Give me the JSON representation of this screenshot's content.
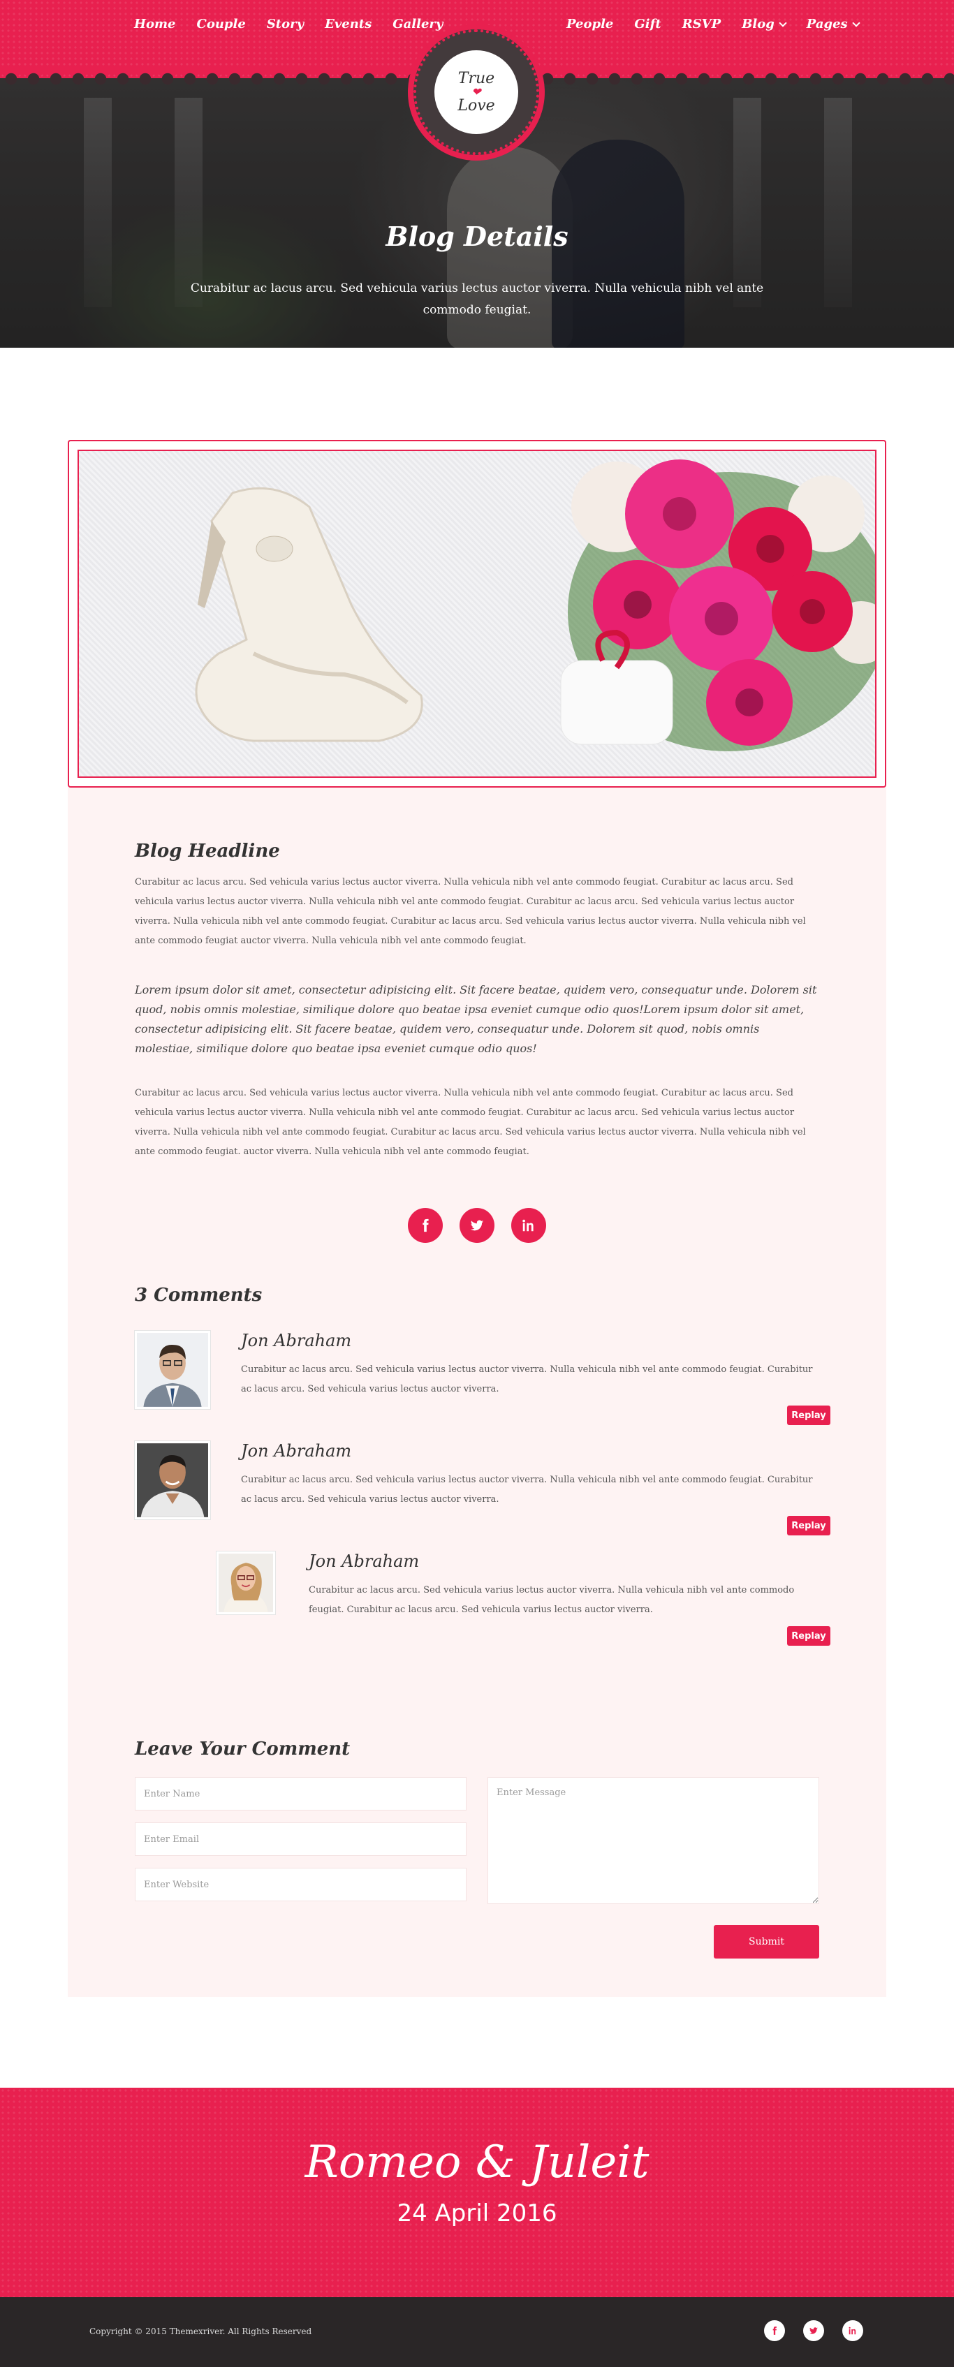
{
  "nav": {
    "left": [
      "Home",
      "Couple",
      "Story",
      "Events",
      "Gallery"
    ],
    "right": [
      "People",
      "Gift",
      "RSVP",
      "Blog",
      "Pages"
    ]
  },
  "logo": {
    "line1": "True",
    "line2": "Love"
  },
  "hero": {
    "title": "Blog Details",
    "subtitle": "Curabitur ac lacus arcu. Sed vehicula varius lectus auctor viverra. Nulla vehicula nibh vel ante commodo feugiat."
  },
  "post": {
    "headline": "Blog Headline",
    "paragraph1": "Curabitur ac lacus arcu. Sed vehicula varius lectus auctor viverra. Nulla vehicula nibh vel ante commodo feugiat. Curabitur ac lacus arcu. Sed vehicula varius lectus auctor viverra. Nulla vehicula nibh vel ante commodo feugiat. Curabitur ac lacus arcu. Sed vehicula varius lectus auctor viverra. Nulla vehicula nibh vel ante commodo feugiat. Curabitur ac lacus arcu. Sed vehicula varius lectus auctor viverra. Nulla vehicula nibh vel ante commodo feugiat auctor viverra. Nulla vehicula nibh vel ante commodo feugiat.",
    "quote": "Lorem ipsum dolor sit amet, consectetur adipisicing elit. Sit facere beatae, quidem vero, consequatur unde. Dolorem sit quod, nobis omnis molestiae, similique dolore quo beatae ipsa eveniet cumque odio quos!Lorem ipsum dolor sit amet, consectetur adipisicing elit. Sit facere beatae, quidem vero, consequatur unde. Dolorem sit quod, nobis omnis molestiae, similique dolore quo beatae ipsa eveniet cumque odio quos!",
    "paragraph2": "Curabitur ac lacus arcu. Sed vehicula varius lectus auctor viverra. Nulla vehicula nibh vel ante commodo feugiat. Curabitur ac lacus arcu. Sed vehicula varius lectus auctor viverra. Nulla vehicula nibh vel ante commodo feugiat. Curabitur ac lacus arcu. Sed vehicula varius lectus auctor viverra. Nulla vehicula nibh vel ante commodo feugiat. Curabitur ac lacus arcu. Sed vehicula varius lectus auctor viverra. Nulla vehicula nibh vel ante commodo feugiat. auctor viverra. Nulla vehicula nibh vel ante commodo feugiat."
  },
  "share": {
    "icons": [
      "facebook-icon",
      "twitter-icon",
      "linkedin-icon"
    ]
  },
  "comments": {
    "title": "3 Comments",
    "items": [
      {
        "name": "Jon Abraham",
        "text": "Curabitur ac lacus arcu. Sed vehicula varius lectus auctor viverra. Nulla vehicula nibh vel ante commodo feugiat. Curabitur ac lacus arcu. Sed vehicula varius lectus auctor viverra.",
        "reply": "Replay"
      },
      {
        "name": "Jon Abraham",
        "text": "Curabitur ac lacus arcu. Sed vehicula varius lectus auctor viverra. Nulla vehicula nibh vel ante commodo feugiat. Curabitur ac lacus arcu. Sed vehicula varius lectus auctor viverra.",
        "reply": "Replay"
      },
      {
        "name": "Jon Abraham",
        "text": "Curabitur ac lacus arcu. Sed vehicula varius lectus auctor viverra. Nulla vehicula nibh vel ante commodo feugiat. Curabitur ac lacus arcu. Sed vehicula varius lectus auctor viverra.",
        "reply": "Replay"
      }
    ]
  },
  "form": {
    "title": "Leave Your Comment",
    "name_placeholder": "Enter Name",
    "email_placeholder": "Enter Email",
    "website_placeholder": "Enter Website",
    "message_placeholder": "Enter Message",
    "submit": "Submit"
  },
  "footer": {
    "couple": "Romeo & Juleit",
    "date": "24 April 2016",
    "copyright": "Copyright © 2015 Themexriver. All Rights Reserved"
  },
  "colors": {
    "accent": "#e8204f",
    "card_bg": "#fef3f3",
    "footer_bg": "#2a2627"
  }
}
